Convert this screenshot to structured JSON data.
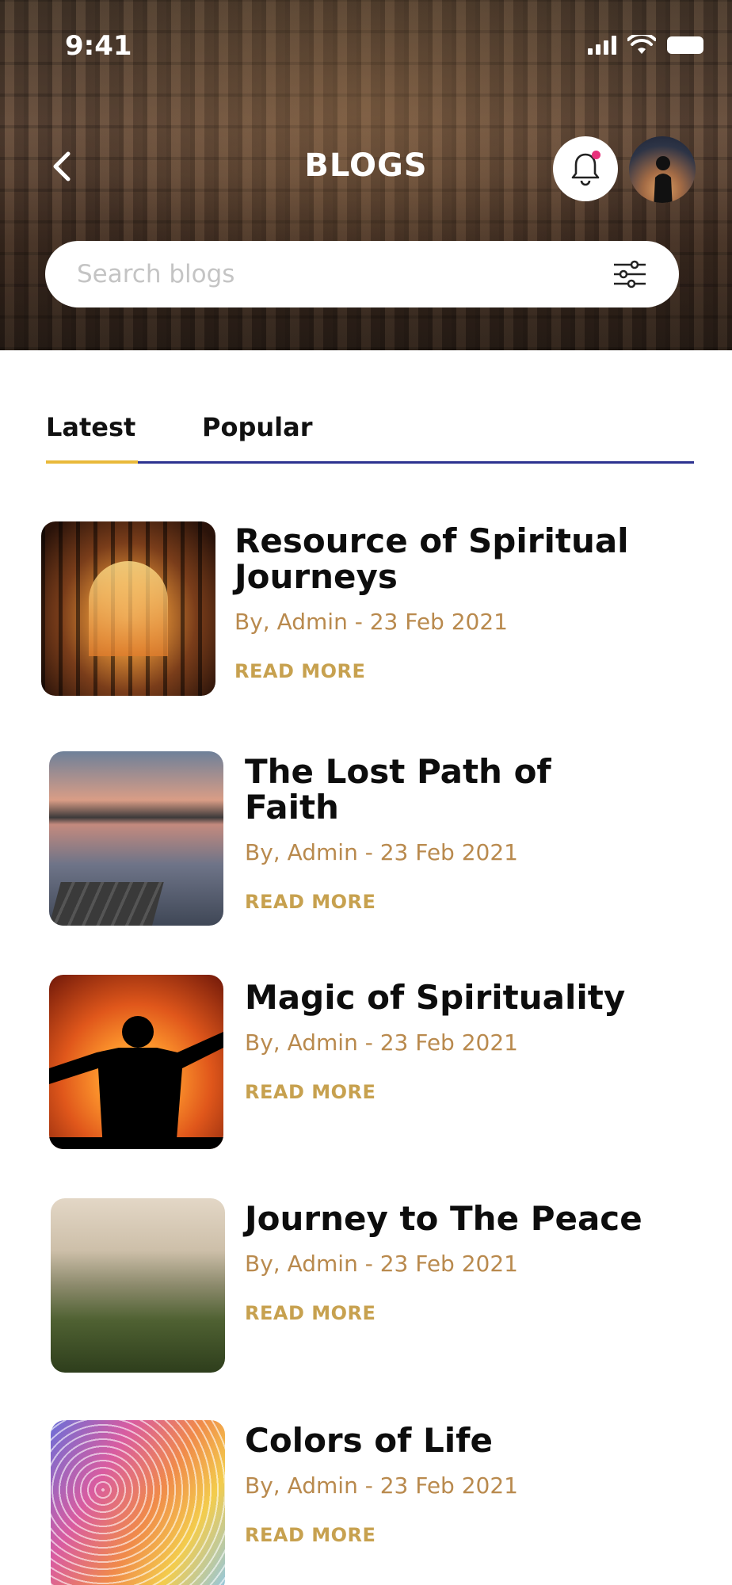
{
  "status": {
    "time": "9:41"
  },
  "header": {
    "title": "BLOGS",
    "search_placeholder": "Search blogs"
  },
  "tabs": [
    {
      "label": "Latest",
      "active": true
    },
    {
      "label": "Popular",
      "active": false
    }
  ],
  "blogs": [
    {
      "title": "Resource of Spiritual Journeys",
      "meta": "By, Admin - 23 Feb 2021",
      "cta": "READ MORE",
      "image": "cathedral-interior"
    },
    {
      "title": "The Lost Path of Faith",
      "meta": "By, Admin - 23 Feb 2021",
      "cta": "READ MORE",
      "image": "lake-dock-sunset"
    },
    {
      "title": "Magic of Spirituality",
      "meta": "By, Admin - 23 Feb 2021",
      "cta": "READ MORE",
      "image": "silhouette-sunset"
    },
    {
      "title": "Journey to The Peace",
      "meta": "By, Admin - 23 Feb 2021",
      "cta": "READ MORE",
      "image": "misty-mountain"
    },
    {
      "title": "Colors of Life",
      "meta": "By, Admin - 23 Feb 2021",
      "cta": "READ MORE",
      "image": "colorful-abstract"
    }
  ],
  "colors": {
    "accent_gold": "#c7a14f",
    "meta_text": "#b98a4e",
    "tab_line": "#2d3390",
    "tab_indicator": "#e9b93a",
    "notification_dot": "#e8317b"
  }
}
